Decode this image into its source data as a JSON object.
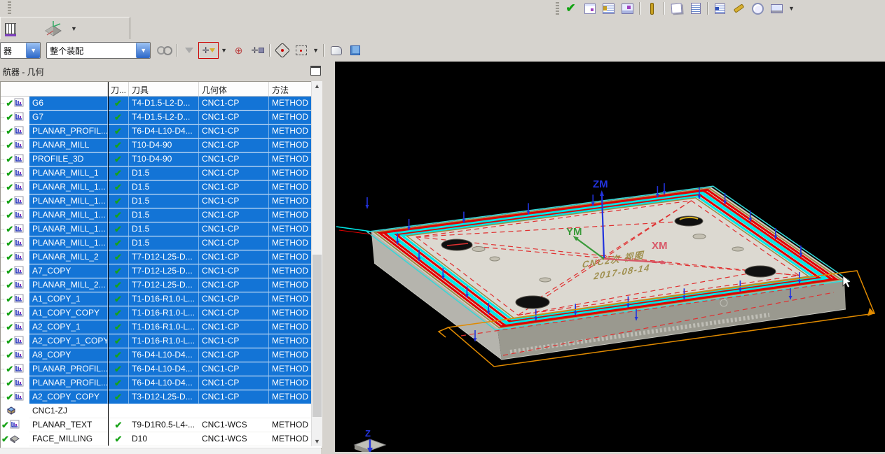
{
  "toolbar_top": {
    "icons": [
      {
        "name": "verify-check-icon"
      },
      {
        "name": "note-page-icon"
      },
      {
        "name": "list-operations-icon"
      },
      {
        "name": "machine-table-icon"
      },
      {
        "name": "sep"
      },
      {
        "name": "plumb-tool-icon"
      },
      {
        "name": "sep"
      },
      {
        "name": "edit-wand-icon"
      },
      {
        "name": "document-icon"
      },
      {
        "name": "sep"
      },
      {
        "name": "list-tool-icon"
      },
      {
        "name": "wrench-icon"
      },
      {
        "name": "clock-icon"
      },
      {
        "name": "workstation-icon"
      },
      {
        "name": "caret"
      }
    ]
  },
  "toolbar_mid": {
    "icons": [
      {
        "name": "snap-grid-icon"
      },
      {
        "name": "datum-csys-icon"
      },
      {
        "name": "caret"
      }
    ]
  },
  "toolbar_row3": {
    "filter_combo_value": "器",
    "assembly_combo_value": "整个装配",
    "icons": [
      {
        "name": "gear-pair-icon"
      },
      {
        "name": "sep"
      },
      {
        "name": "funnel-icon"
      },
      {
        "name": "selection-filter-icon",
        "highlight": true
      },
      {
        "name": "caret"
      },
      {
        "name": "rotate-point-icon"
      },
      {
        "name": "snap-point-icon"
      },
      {
        "name": "sep"
      },
      {
        "name": "hexagon-point-icon"
      },
      {
        "name": "rect-select-icon"
      },
      {
        "name": "caret"
      },
      {
        "name": "sep"
      },
      {
        "name": "shaded-view-icon"
      },
      {
        "name": "wireframe-cube-icon"
      }
    ]
  },
  "navigator": {
    "title": "航器 - 几何",
    "columns": [
      "",
      "刀...",
      "刀具",
      "几何体",
      "方法"
    ],
    "rows": [
      {
        "name": "G6",
        "tool": "T4-D1.5-L2-D...",
        "geom": "CNC1-CP",
        "method": "METHOD",
        "selected": true,
        "icon": "op",
        "check": true,
        "indent": 1
      },
      {
        "name": "G7",
        "tool": "T4-D1.5-L2-D...",
        "geom": "CNC1-CP",
        "method": "METHOD",
        "selected": true,
        "icon": "op",
        "check": true,
        "indent": 1
      },
      {
        "name": "PLANAR_PROFIL...",
        "tool": "T6-D4-L10-D4...",
        "geom": "CNC1-CP",
        "method": "METHOD",
        "selected": true,
        "icon": "op",
        "check": true,
        "indent": 1
      },
      {
        "name": "PLANAR_MILL",
        "tool": "T10-D4-90",
        "geom": "CNC1-CP",
        "method": "METHOD",
        "selected": true,
        "icon": "op",
        "check": true,
        "indent": 1
      },
      {
        "name": "PROFILE_3D",
        "tool": "T10-D4-90",
        "geom": "CNC1-CP",
        "method": "METHOD",
        "selected": true,
        "icon": "op",
        "check": true,
        "indent": 1
      },
      {
        "name": "PLANAR_MILL_1",
        "tool": "D1.5",
        "geom": "CNC1-CP",
        "method": "METHOD",
        "selected": true,
        "icon": "op",
        "check": true,
        "indent": 1
      },
      {
        "name": "PLANAR_MILL_1...",
        "tool": "D1.5",
        "geom": "CNC1-CP",
        "method": "METHOD",
        "selected": true,
        "icon": "op",
        "check": true,
        "indent": 1
      },
      {
        "name": "PLANAR_MILL_1...",
        "tool": "D1.5",
        "geom": "CNC1-CP",
        "method": "METHOD",
        "selected": true,
        "icon": "op",
        "check": true,
        "indent": 1
      },
      {
        "name": "PLANAR_MILL_1...",
        "tool": "D1.5",
        "geom": "CNC1-CP",
        "method": "METHOD",
        "selected": true,
        "icon": "op",
        "check": true,
        "indent": 1
      },
      {
        "name": "PLANAR_MILL_1...",
        "tool": "D1.5",
        "geom": "CNC1-CP",
        "method": "METHOD",
        "selected": true,
        "icon": "op",
        "check": true,
        "indent": 1
      },
      {
        "name": "PLANAR_MILL_1...",
        "tool": "D1.5",
        "geom": "CNC1-CP",
        "method": "METHOD",
        "selected": true,
        "icon": "op",
        "check": true,
        "indent": 1
      },
      {
        "name": "PLANAR_MILL_2",
        "tool": "T7-D12-L25-D...",
        "geom": "CNC1-CP",
        "method": "METHOD",
        "selected": true,
        "icon": "op",
        "check": true,
        "indent": 1
      },
      {
        "name": "A7_COPY",
        "tool": "T7-D12-L25-D...",
        "geom": "CNC1-CP",
        "method": "METHOD",
        "selected": true,
        "icon": "op",
        "check": true,
        "indent": 1
      },
      {
        "name": "PLANAR_MILL_2...",
        "tool": "T7-D12-L25-D...",
        "geom": "CNC1-CP",
        "method": "METHOD",
        "selected": true,
        "icon": "op",
        "check": true,
        "indent": 1
      },
      {
        "name": "A1_COPY_1",
        "tool": "T1-D16-R1.0-L...",
        "geom": "CNC1-CP",
        "method": "METHOD",
        "selected": true,
        "icon": "op",
        "check": true,
        "indent": 1
      },
      {
        "name": "A1_COPY_COPY",
        "tool": "T1-D16-R1.0-L...",
        "geom": "CNC1-CP",
        "method": "METHOD",
        "selected": true,
        "icon": "op",
        "check": true,
        "indent": 1
      },
      {
        "name": "A2_COPY_1",
        "tool": "T1-D16-R1.0-L...",
        "geom": "CNC1-CP",
        "method": "METHOD",
        "selected": true,
        "icon": "op",
        "check": true,
        "indent": 1
      },
      {
        "name": "A2_COPY_1_COPY",
        "tool": "T1-D16-R1.0-L...",
        "geom": "CNC1-CP",
        "method": "METHOD",
        "selected": true,
        "icon": "op",
        "check": true,
        "indent": 1
      },
      {
        "name": "A8_COPY",
        "tool": "T6-D4-L10-D4...",
        "geom": "CNC1-CP",
        "method": "METHOD",
        "selected": true,
        "icon": "op",
        "check": true,
        "indent": 1
      },
      {
        "name": "PLANAR_PROFIL...",
        "tool": "T6-D4-L10-D4...",
        "geom": "CNC1-CP",
        "method": "METHOD",
        "selected": true,
        "icon": "op",
        "check": true,
        "indent": 1
      },
      {
        "name": "PLANAR_PROFIL...",
        "tool": "T6-D4-L10-D4...",
        "geom": "CNC1-CP",
        "method": "METHOD",
        "selected": true,
        "icon": "op",
        "check": true,
        "indent": 1
      },
      {
        "name": "A2_COPY_COPY",
        "tool": "T3-D12-L25-D...",
        "geom": "CNC1-CP",
        "method": "METHOD",
        "selected": true,
        "icon": "op",
        "check": true,
        "indent": 1
      },
      {
        "name": "CNC1-ZJ",
        "tool": "",
        "geom": "",
        "method": "",
        "selected": false,
        "icon": "group",
        "check": false,
        "indent": 0
      },
      {
        "name": "PLANAR_TEXT",
        "tool": "T9-D1R0.5-L4-...",
        "geom": "CNC1-WCS",
        "method": "METHOD",
        "selected": false,
        "icon": "op",
        "check": true,
        "indent": 0
      },
      {
        "name": "FACE_MILLING",
        "tool": "D10",
        "geom": "CNC1-WCS",
        "method": "METHOD",
        "selected": false,
        "icon": "face",
        "check": true,
        "indent": 0
      }
    ]
  },
  "viewport": {
    "axes": {
      "x": "XM",
      "y": "YM",
      "z": "ZM",
      "corner": "Z"
    },
    "engraving": [
      "CNC2次 视图",
      "2017-08-14"
    ],
    "colors": {
      "selection": "#1374d6",
      "path_red": "#e00000",
      "path_cyan": "#00e6e6",
      "path_olive": "#9b8a45",
      "rapid_red": "#e03030",
      "boundary_orange": "#e08a00",
      "axis_z": "#2233dd",
      "axis_y": "#3a9a3a",
      "axis_x": "#d85868",
      "face_top": "#dcd9d1",
      "face_left": "#b5b4ad",
      "face_right": "#9a998f"
    }
  }
}
